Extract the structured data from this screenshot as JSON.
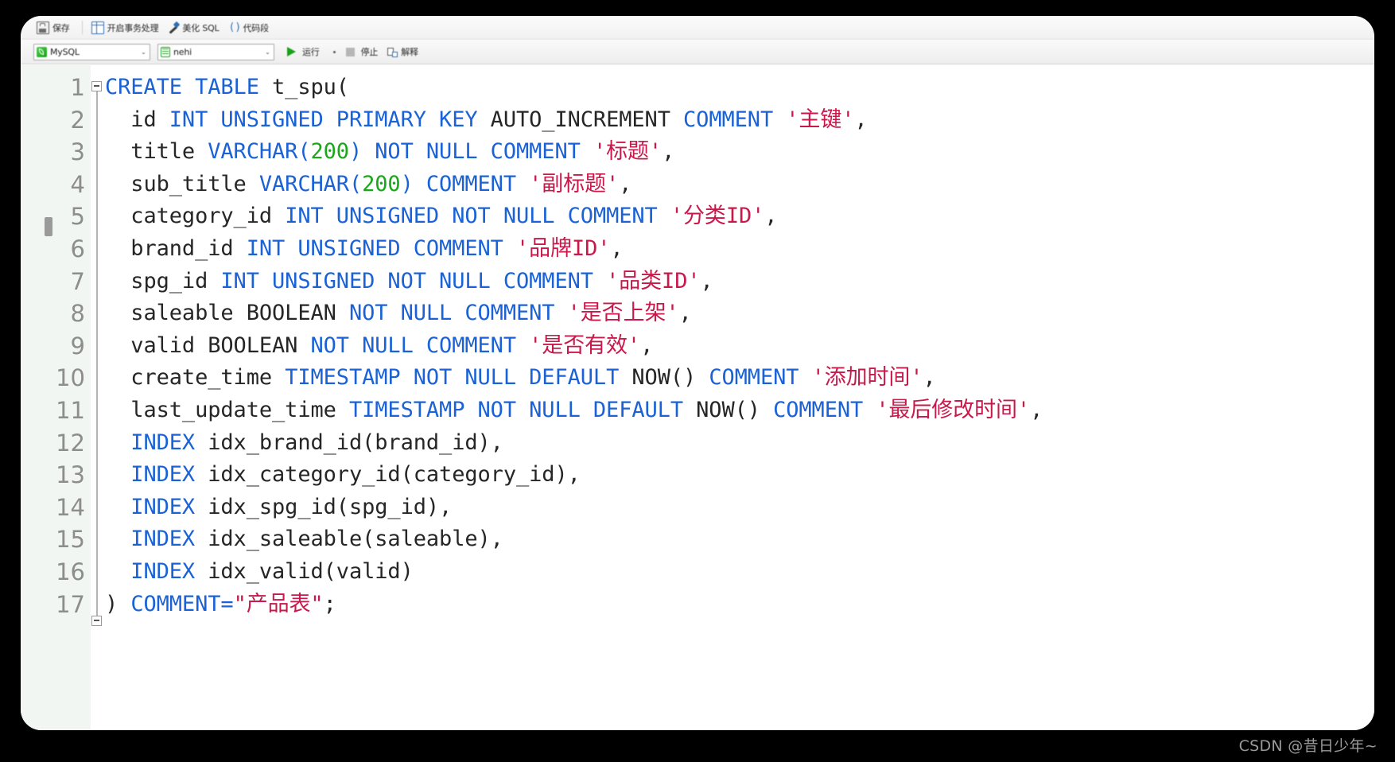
{
  "window": {
    "background": "#000000",
    "panel_background": "#ffffff"
  },
  "toolbar_top": {
    "items": [
      {
        "icon": "save-icon",
        "label": "保存"
      },
      {
        "icon": "table-icon",
        "label": "开启事务处理"
      },
      {
        "icon": "wand-icon",
        "label": "美化 SQL"
      },
      {
        "icon": "parentheses-icon",
        "label": "代码段"
      }
    ]
  },
  "toolbar_second": {
    "connection_select": {
      "icon": "mysql-icon",
      "value": "MySQL",
      "arrow": "⌄"
    },
    "database_select": {
      "icon": "database-icon",
      "value": "nehi",
      "arrow": "⌄"
    },
    "run_button": {
      "icon": "run-icon",
      "label": "运行"
    },
    "stop_button": {
      "icon": "stop-icon",
      "label": "停止"
    },
    "explain_button": {
      "icon": "explain-icon",
      "label": "解释"
    }
  },
  "editor": {
    "line_numbers": [
      "1",
      "2",
      "3",
      "4",
      "5",
      "6",
      "7",
      "8",
      "9",
      "10",
      "11",
      "12",
      "13",
      "14",
      "15",
      "16",
      "17"
    ],
    "colors": {
      "keyword": "#1a62d6",
      "identifier": "#262626",
      "number": "#1aa81a",
      "string": "#c9184a",
      "gutter_text": "#8d8d8d",
      "gutter_bg": "#f2f6f3"
    },
    "lines": [
      [
        {
          "t": "CREATE TABLE ",
          "c": "kw"
        },
        {
          "t": "t_spu(",
          "c": "id"
        }
      ],
      [
        {
          "t": "  id ",
          "c": "id"
        },
        {
          "t": "INT UNSIGNED PRIMARY KEY ",
          "c": "kw"
        },
        {
          "t": "AUTO_INCREMENT ",
          "c": "id"
        },
        {
          "t": "COMMENT ",
          "c": "kw"
        },
        {
          "t": "'主键'",
          "c": "str"
        },
        {
          "t": ",",
          "c": "pn"
        }
      ],
      [
        {
          "t": "  title ",
          "c": "id"
        },
        {
          "t": "VARCHAR",
          "c": "kw"
        },
        {
          "t": "(",
          "c": "kw"
        },
        {
          "t": "200",
          "c": "num"
        },
        {
          "t": ") ",
          "c": "kw"
        },
        {
          "t": "NOT NULL COMMENT ",
          "c": "kw"
        },
        {
          "t": "'标题'",
          "c": "str"
        },
        {
          "t": ",",
          "c": "pn"
        }
      ],
      [
        {
          "t": "  sub_title ",
          "c": "id"
        },
        {
          "t": "VARCHAR",
          "c": "kw"
        },
        {
          "t": "(",
          "c": "kw"
        },
        {
          "t": "200",
          "c": "num"
        },
        {
          "t": ") ",
          "c": "kw"
        },
        {
          "t": "COMMENT ",
          "c": "kw"
        },
        {
          "t": "'副标题'",
          "c": "str"
        },
        {
          "t": ",",
          "c": "pn"
        }
      ],
      [
        {
          "t": "  category_id ",
          "c": "id"
        },
        {
          "t": "INT UNSIGNED NOT NULL COMMENT ",
          "c": "kw"
        },
        {
          "t": "'分类ID'",
          "c": "str"
        },
        {
          "t": ",",
          "c": "pn"
        }
      ],
      [
        {
          "t": "  brand_id ",
          "c": "id"
        },
        {
          "t": "INT UNSIGNED COMMENT ",
          "c": "kw"
        },
        {
          "t": "'品牌ID'",
          "c": "str"
        },
        {
          "t": ",",
          "c": "pn"
        }
      ],
      [
        {
          "t": "  spg_id ",
          "c": "id"
        },
        {
          "t": "INT UNSIGNED NOT NULL COMMENT ",
          "c": "kw"
        },
        {
          "t": "'品类ID'",
          "c": "str"
        },
        {
          "t": ",",
          "c": "pn"
        }
      ],
      [
        {
          "t": "  saleable BOOLEAN ",
          "c": "id"
        },
        {
          "t": "NOT NULL COMMENT ",
          "c": "kw"
        },
        {
          "t": "'是否上架'",
          "c": "str"
        },
        {
          "t": ",",
          "c": "pn"
        }
      ],
      [
        {
          "t": "  valid BOOLEAN ",
          "c": "id"
        },
        {
          "t": "NOT NULL COMMENT ",
          "c": "kw"
        },
        {
          "t": "'是否有效'",
          "c": "str"
        },
        {
          "t": ",",
          "c": "pn"
        }
      ],
      [
        {
          "t": "  create_time ",
          "c": "id"
        },
        {
          "t": "TIMESTAMP NOT NULL DEFAULT ",
          "c": "kw"
        },
        {
          "t": "NOW() ",
          "c": "id"
        },
        {
          "t": "COMMENT ",
          "c": "kw"
        },
        {
          "t": "'添加时间'",
          "c": "str"
        },
        {
          "t": ",",
          "c": "pn"
        }
      ],
      [
        {
          "t": "  last_update_time ",
          "c": "id"
        },
        {
          "t": "TIMESTAMP NOT NULL DEFAULT ",
          "c": "kw"
        },
        {
          "t": "NOW() ",
          "c": "id"
        },
        {
          "t": "COMMENT ",
          "c": "kw"
        },
        {
          "t": "'最后修改时间'",
          "c": "str"
        },
        {
          "t": ",",
          "c": "pn"
        }
      ],
      [
        {
          "t": "  INDEX ",
          "c": "kw"
        },
        {
          "t": "idx_brand_id(brand_id),",
          "c": "id"
        }
      ],
      [
        {
          "t": "  INDEX ",
          "c": "kw"
        },
        {
          "t": "idx_category_id(category_id),",
          "c": "id"
        }
      ],
      [
        {
          "t": "  INDEX ",
          "c": "kw"
        },
        {
          "t": "idx_spg_id(spg_id),",
          "c": "id"
        }
      ],
      [
        {
          "t": "  INDEX ",
          "c": "kw"
        },
        {
          "t": "idx_saleable(saleable),",
          "c": "id"
        }
      ],
      [
        {
          "t": "  INDEX ",
          "c": "kw"
        },
        {
          "t": "idx_valid(valid)",
          "c": "id"
        }
      ],
      [
        {
          "t": ") ",
          "c": "id"
        },
        {
          "t": "COMMENT=",
          "c": "kw"
        },
        {
          "t": "\"产品表\"",
          "c": "str"
        },
        {
          "t": ";",
          "c": "pn"
        }
      ]
    ]
  },
  "watermark": {
    "text": "CSDN @昔日少年~"
  }
}
